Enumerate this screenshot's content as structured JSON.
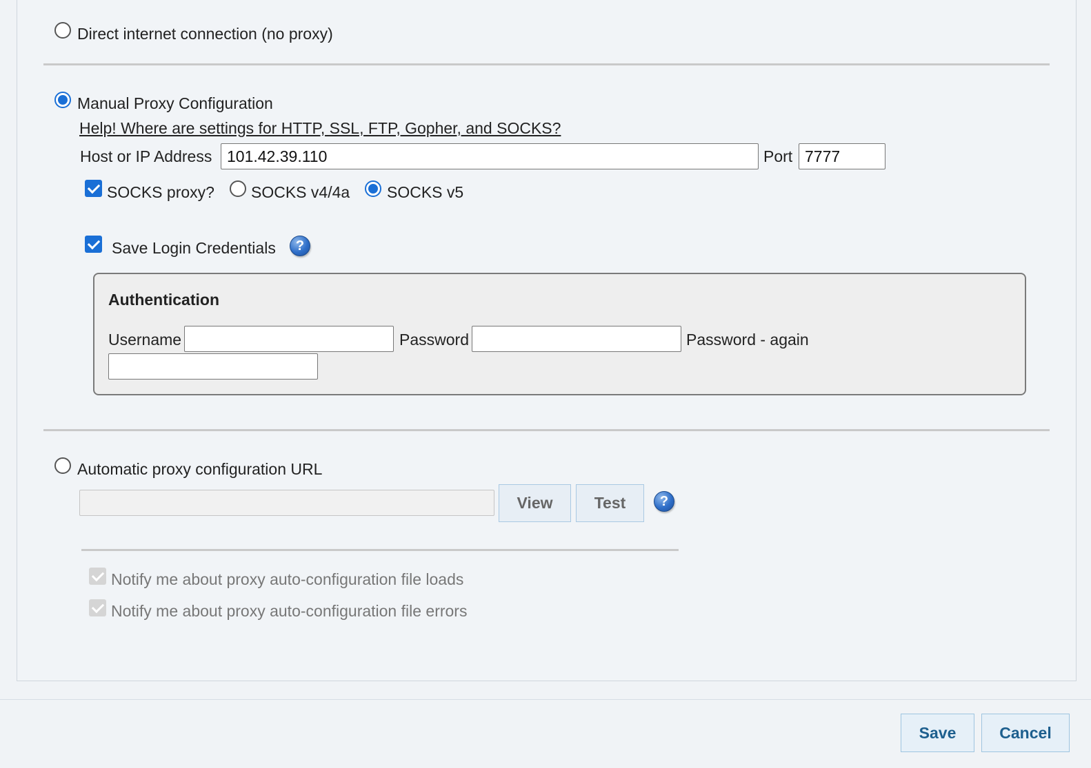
{
  "direct": {
    "label": "Direct internet connection (no proxy)",
    "selected": false
  },
  "manual": {
    "label": "Manual Proxy Configuration",
    "selected": true,
    "help_link": "Help! Where are settings for HTTP, SSL, FTP, Gopher, and SOCKS?",
    "host_label": "Host or IP Address",
    "host_value": "101.42.39.110",
    "port_label": "Port",
    "port_value": "7777",
    "socks_label": "SOCKS proxy?",
    "socks_checked": true,
    "socks_v4_label": "SOCKS v4/4a",
    "socks_v5_label": "SOCKS v5",
    "socks_version_selected": "v5",
    "save_creds_label": "Save Login Credentials",
    "save_creds_checked": true,
    "help_icon": "question-help-icon"
  },
  "auth": {
    "title": "Authentication",
    "username_label": "Username",
    "username_value": "",
    "password_label": "Password",
    "password_value": "",
    "password_again_label": "Password - again",
    "password_again_value": ""
  },
  "auto": {
    "label": "Automatic proxy configuration URL",
    "selected": false,
    "url_value": "",
    "view_label": "View",
    "test_label": "Test",
    "notify_loads_label": "Notify me about proxy auto-configuration file loads",
    "notify_errors_label": "Notify me about proxy auto-configuration file errors",
    "notify_loads_checked": true,
    "notify_errors_checked": true
  },
  "footer": {
    "save_label": "Save",
    "cancel_label": "Cancel"
  },
  "colors": {
    "accent": "#1a6fd6",
    "button_text": "#1d5f8e",
    "background": "#f1f4f7"
  }
}
